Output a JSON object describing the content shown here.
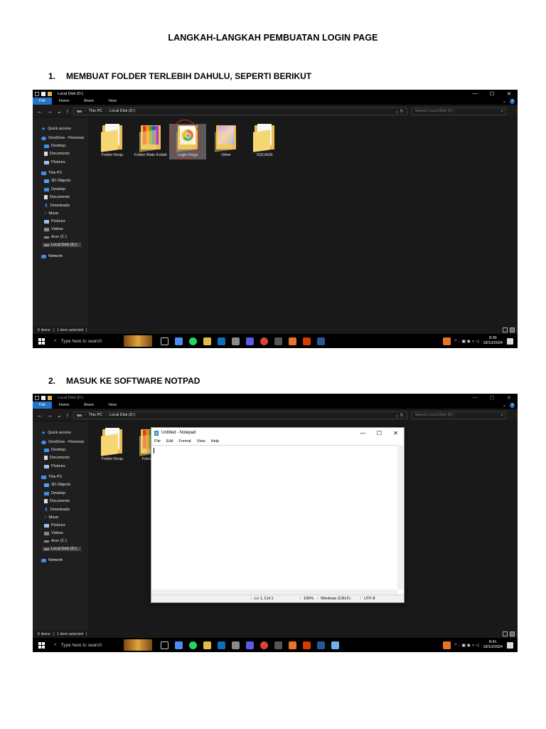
{
  "document": {
    "title": "LANGKAH-LANGKAH PEMBUATAN LOGIN PAGE",
    "steps": [
      {
        "number": "1.",
        "heading": "MEMBUAT FOLDER TERLEBIH DAHULU, SEPERTI BERIKUT"
      },
      {
        "number": "2.",
        "heading": "MASUK KE SOFTWARE NOTPAD"
      }
    ]
  },
  "explorer": {
    "window_title": "Local Disk (D:)",
    "controls": {
      "minimize": "—",
      "maximize": "☐",
      "close": "✕"
    },
    "ribbon_tabs": [
      "File",
      "Home",
      "Share",
      "View"
    ],
    "ribbon_right": {
      "chevron": "⌄",
      "help": "?"
    },
    "nav_buttons": {
      "back": "←",
      "forward": "→",
      "recent": "⌄",
      "up": "↑"
    },
    "breadcrumb": [
      "This PC",
      "Local Disk (D:)"
    ],
    "breadcrumb_sep": "›",
    "address_tail": "⌄ ↻",
    "search_placeholder": "Search Local Disk (D:)",
    "search_glyph": "⌕",
    "nav_pane": {
      "quick_access": "Quick access",
      "onedrive": "OneDrive - Personal",
      "onedrive_items": [
        "Desktop",
        "Documents",
        "Pictures"
      ],
      "this_pc": "This PC",
      "this_pc_items": [
        "3D Objects",
        "Desktop",
        "Documents",
        "Downloads",
        "Music",
        "Pictures",
        "Videos",
        "Acer (C:)",
        "Local Disk (D:)"
      ],
      "network": "Network"
    },
    "folders": [
      "Folder Kerja",
      "Folder Mate Kuliah",
      "Login Page",
      "Other",
      "SSCASN"
    ],
    "folders_partial": [
      "Folder Kerja",
      "Folde Kuli"
    ],
    "status": {
      "items": "5 items",
      "divider": "|",
      "selected": "1 item selected"
    }
  },
  "taskbar": {
    "search_placeholder": "Type here to search",
    "search_glyph": "⌕",
    "tray_glyphs": "^ ◌ ▣ ◉ ◖ ◁",
    "accent_colors": [
      "#4e8cf5",
      "#25d366",
      "#e8b84a",
      "#0f6cbd",
      "#8a8a8a",
      "#5a5ae8",
      "#db4437",
      "#555555",
      "#e8742a",
      "#d83b01",
      "#2b579a"
    ]
  },
  "shots": [
    {
      "clock_time": "8:39",
      "clock_date": "18/10/2024"
    },
    {
      "clock_time": "8:41",
      "clock_date": "18/10/2024"
    }
  ],
  "notepad": {
    "title": "Untitled - Notepad",
    "controls": {
      "minimize": "—",
      "maximize": "☐",
      "close": "✕"
    },
    "menu": [
      "File",
      "Edit",
      "Format",
      "View",
      "Help"
    ],
    "status": {
      "position": "Ln 1, Col 1",
      "zoom": "100%",
      "line_endings": "Windows (CRLF)",
      "encoding": "UTF-8"
    }
  },
  "colors": {
    "highlight_circle": "#e02424",
    "file_tab": "#2474c9",
    "folder": "#e9bf55"
  }
}
